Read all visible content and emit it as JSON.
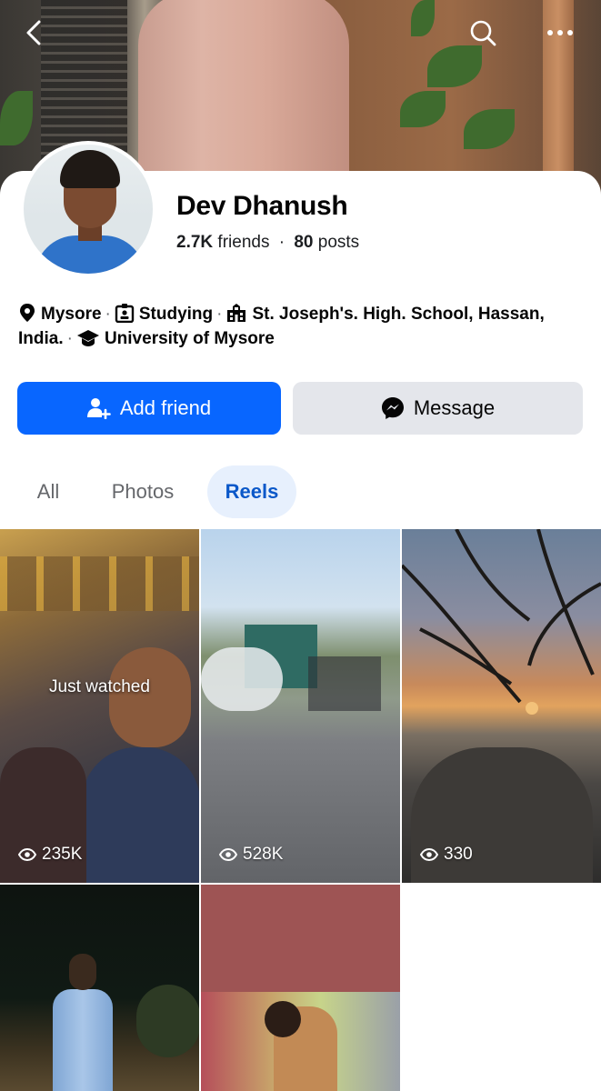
{
  "profile": {
    "name": "Dev Dhanush",
    "friends_count": "2.7K",
    "friends_label": "friends",
    "separator": "·",
    "posts_count": "80",
    "posts_label": "posts"
  },
  "info": {
    "location": "Mysore",
    "status": "Studying",
    "school": "St. Joseph's. High. School, Hassan, India.",
    "university": "University of Mysore",
    "separator": "·"
  },
  "actions": {
    "add_friend_label": "Add friend",
    "message_label": "Message"
  },
  "tabs": [
    {
      "label": "All",
      "active": false
    },
    {
      "label": "Photos",
      "active": false
    },
    {
      "label": "Reels",
      "active": true
    }
  ],
  "reels": [
    {
      "views": "235K",
      "badge": "Just watched"
    },
    {
      "views": "528K"
    },
    {
      "views": "330"
    },
    {},
    {}
  ],
  "icons": {
    "back": "chevron-left-icon",
    "search": "search-icon",
    "more": "more-horizontal-icon",
    "location": "location-pin-icon",
    "status": "id-card-icon",
    "school": "school-building-icon",
    "university": "graduation-cap-icon",
    "add_friend": "add-person-icon",
    "message": "messenger-icon",
    "views": "eye-icon"
  },
  "colors": {
    "primary": "#0866ff",
    "secondary_button": "#e4e6eb",
    "active_tab_bg": "#e7f0fd",
    "active_tab_text": "#0b58c9",
    "muted_text": "#65676b"
  }
}
